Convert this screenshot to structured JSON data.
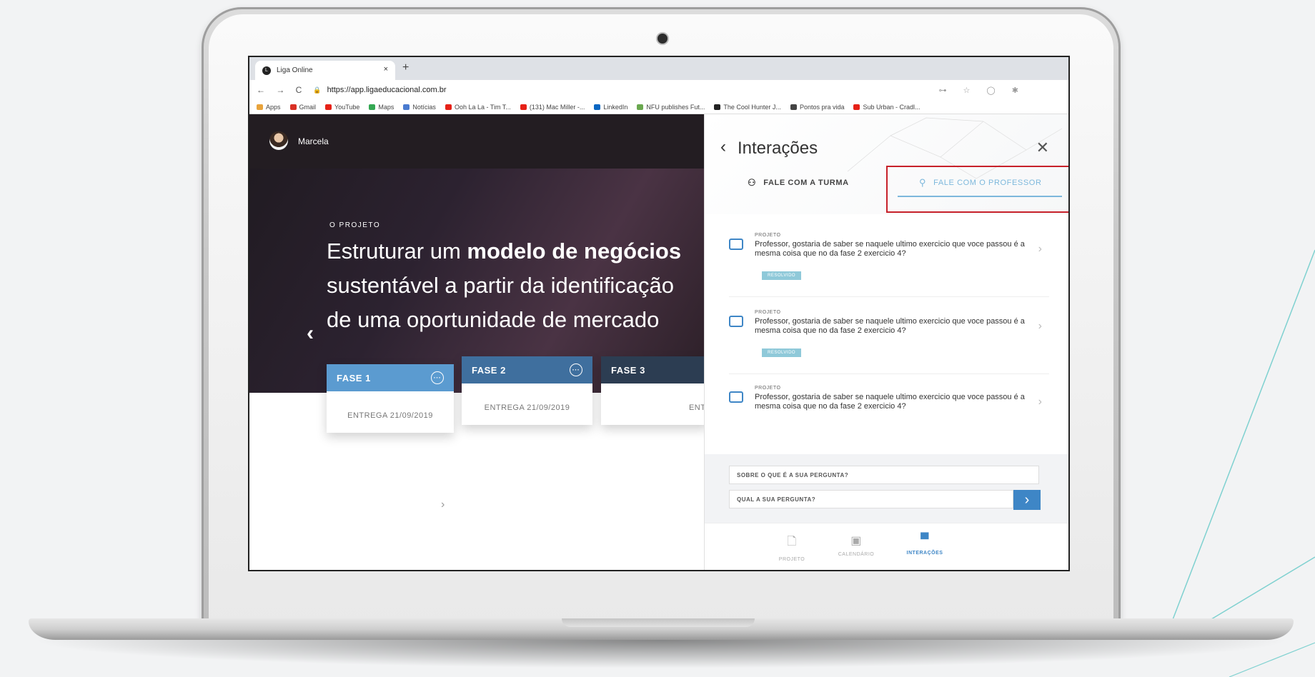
{
  "browser": {
    "tab_title": "Liga Online",
    "tab_close": "×",
    "new_tab": "+",
    "nav_controls": "← → C",
    "lock": "🔒",
    "url": "https://app.ligaeducacional.com.br",
    "tools": "⊶ ☆ ◯ ✱",
    "bookmarks": [
      {
        "label": "Apps",
        "color": "#e8a33c"
      },
      {
        "label": "Gmail",
        "color": "#d93025"
      },
      {
        "label": "YouTube",
        "color": "#e62117"
      },
      {
        "label": "Maps",
        "color": "#34a853"
      },
      {
        "label": "Notícias",
        "color": "#4a7bd0"
      },
      {
        "label": "Ooh La La - Tim T...",
        "color": "#e62117"
      },
      {
        "label": "(131) Mac Miller -...",
        "color": "#e62117"
      },
      {
        "label": "LinkedIn",
        "color": "#0a66c2"
      },
      {
        "label": "NFU publishes Fut...",
        "color": "#6aa84f"
      },
      {
        "label": "The Cool Hunter J...",
        "color": "#222222"
      },
      {
        "label": "Pontos pra vida",
        "color": "#444444"
      },
      {
        "label": "Sub Urban - Cradl...",
        "color": "#e62117"
      }
    ]
  },
  "user": {
    "name": "Marcela"
  },
  "hero": {
    "kicker": "O PROJETO",
    "title_pre": "Estruturar um ",
    "title_bold": "modelo de negócios",
    "title_post": " sustentável a partir da identificação de uma oportunidade de mercado",
    "prev_arrow": "‹"
  },
  "phases": [
    {
      "label": "FASE 1",
      "delivery": "ENTREGA 21/09/2019",
      "color": "#5b9bd0"
    },
    {
      "label": "FASE 2",
      "delivery": "ENTREGA 21/09/2019",
      "color": "#3f6f9e"
    },
    {
      "label": "FASE 3",
      "delivery": "ENTI",
      "color": "#2c3d52"
    }
  ],
  "phase_menu": "···",
  "pager_arrow": "›",
  "panel": {
    "back": "‹",
    "title": "Interações",
    "close": "✕",
    "tab_class": "FALE COM A TURMA",
    "tab_teacher": "FALE COM O PROFESSOR",
    "tab_class_icon": "group-icon",
    "tab_teacher_icon": "person-icon",
    "accent_color": "#3e86c6",
    "highlight_color": "#c7212a"
  },
  "messages": [
    {
      "category": "PROJETO",
      "text": "Professor, gostaria de saber se naquele ultimo exercicio que voce passou é a mesma coisa que no da fase 2 exercicio 4?",
      "badge": "RESOLVIDO"
    },
    {
      "category": "PROJETO",
      "text": "Professor, gostaria de saber se naquele ultimo exercicio que voce passou é a mesma coisa que no da fase 2 exercicio 4?",
      "badge": "RESOLVIDO"
    },
    {
      "category": "PROJETO",
      "text": "Professor, gostaria de saber se naquele ultimo exercicio que voce passou é a mesma coisa que no da fase 2 exercicio 4?",
      "badge": ""
    }
  ],
  "message_chevron": "›",
  "form": {
    "subject_placeholder": "SOBRE O QUE É A SUA PERGUNTA?",
    "question_placeholder": "QUAL A SUA PERGUNTA?",
    "send_icon": "›"
  },
  "bottom_nav": [
    {
      "label": "PROJETO",
      "icon": "🗋",
      "active": false
    },
    {
      "label": "CALENDÁRIO",
      "icon": "▣",
      "active": false
    },
    {
      "label": "INTERAÇÕES",
      "icon": "▀",
      "active": true
    }
  ]
}
